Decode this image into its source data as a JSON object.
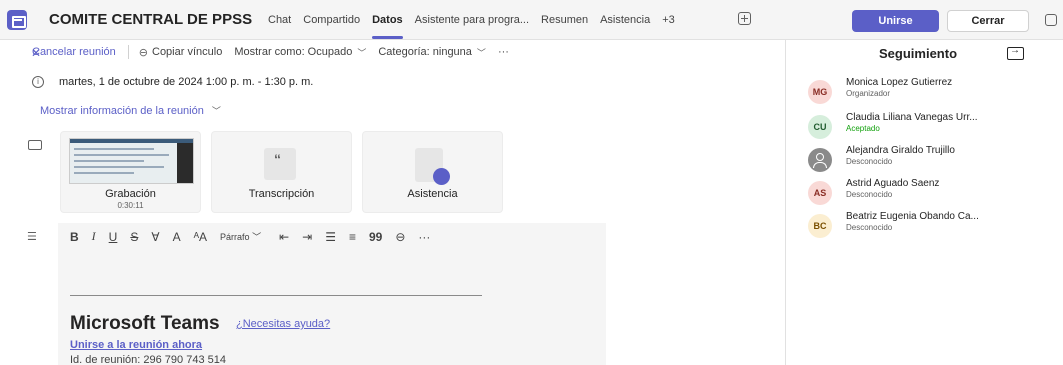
{
  "header": {
    "title": "COMITE CENTRAL DE PPSS",
    "tabs": [
      "Chat",
      "Compartido",
      "Datos",
      "Asistente para progra...",
      "Resumen",
      "Asistencia",
      "+3"
    ],
    "active_tab": "Datos",
    "join_label": "Unirse",
    "close_label": "Cerrar",
    "accent": "#5b5fc7"
  },
  "toolbar": {
    "cancel_label": "Cancelar reunión",
    "copy_link_label": "Copiar vínculo",
    "show_as_label": "Mostrar como: Ocupado",
    "category_label": "Categoría: ninguna",
    "more_label": "···"
  },
  "meeting": {
    "datetime": "martes, 1 de octubre de 2024 1:00 p. m. - 1:30 p. m.",
    "show_info_label": "Mostrar información de la reunión"
  },
  "cards": [
    {
      "label": "Grabación",
      "sub": "0:30:11"
    },
    {
      "label": "Transcripción",
      "sub": ""
    },
    {
      "label": "Asistencia",
      "sub": ""
    }
  ],
  "editor": {
    "paragraph_label": "Párrafo",
    "teams_title": "Microsoft Teams",
    "help_link": "¿Necesitas ayuda?",
    "join_now": "Unirse a la reunión ahora",
    "meeting_id": "Id. de reunión: 296 790 743 514"
  },
  "panel": {
    "title": "Seguimiento",
    "people": [
      {
        "initials": "MG",
        "name": "Monica Lopez Gutierrez",
        "status": "Organizador",
        "color": "#f9d9d6",
        "text_color": "#8a2d25"
      },
      {
        "initials": "CU",
        "name": "Claudia Liliana Vanegas Urr...",
        "status": "Aceptado",
        "color": "#d6eedc",
        "text_color": "#1f5b2e"
      },
      {
        "initials": "",
        "name": "Alejandra Giraldo Trujillo",
        "status": "Desconocido",
        "color": "#8a8a8a",
        "text_color": "#ffffff"
      },
      {
        "initials": "AS",
        "name": "Astrid Aguado Saenz",
        "status": "Desconocido",
        "color": "#f9d9d6",
        "text_color": "#8a2d25"
      },
      {
        "initials": "BC",
        "name": "Beatriz Eugenia Obando Ca...",
        "status": "Desconocido",
        "color": "#fbeed1",
        "text_color": "#7a4f00"
      }
    ]
  }
}
